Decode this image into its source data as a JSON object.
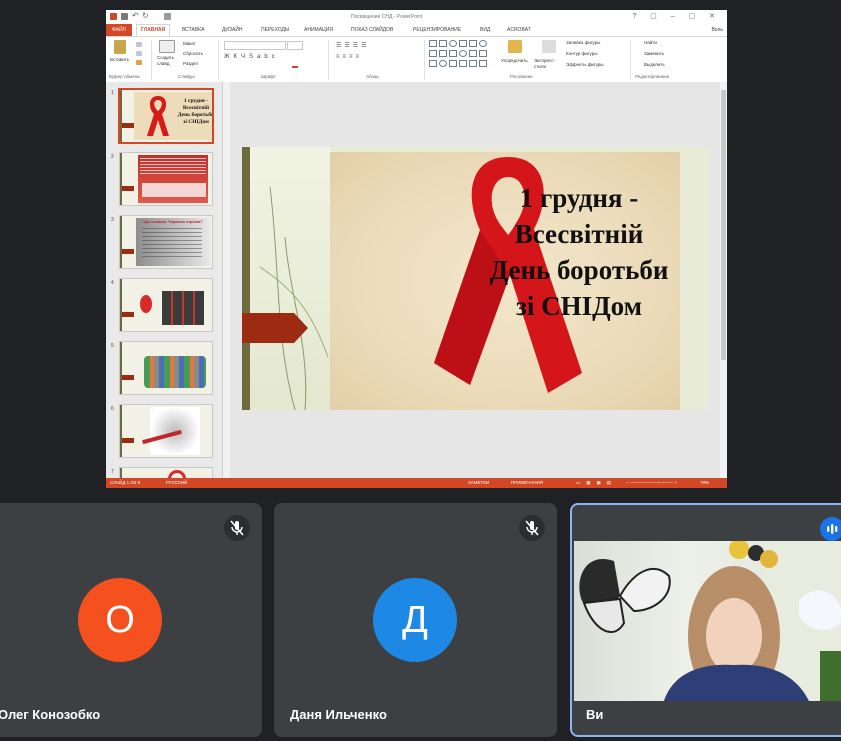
{
  "powerpoint": {
    "window_title": "Посвящение СНД - PowerPoint",
    "user": "Воль",
    "tabs": {
      "file": "ФАЙЛ",
      "home": "ГЛАВНАЯ",
      "insert": "ВСТАВКА",
      "design": "ДИЗАЙН",
      "transitions": "ПЕРЕХОДЫ",
      "animation": "АНИМАЦИЯ",
      "slideshow": "ПОКАЗ СЛАЙДОВ",
      "review": "РЕЦЕНЗИРОВАНИЕ",
      "view": "ВИД",
      "acrobat": "ACROBAT"
    },
    "ribbon": {
      "paste": "Вставить",
      "layout": "Макет",
      "reset": "Сбросить",
      "section": "Раздел",
      "new_slide": "Создать слайд",
      "arrange": "Упорядочить",
      "quick_styles": "Экспресс-стили",
      "fill": "Заливка фигуры",
      "outline": "Контур фигуры",
      "effects": "Эффекты фигуры",
      "find": "Найти",
      "replace": "Заменить",
      "select": "Выделить",
      "groups": {
        "clipboard": "Буфер обмена",
        "slides": "Слайды",
        "font": "Шрифт",
        "paragraph": "Абзац",
        "drawing": "Рисование",
        "editing": "Редактирование"
      }
    },
    "thumbnails": [
      "1",
      "2",
      "3",
      "4",
      "5",
      "6",
      "7"
    ],
    "slide": {
      "title": "1 грудня -\nВсесвітній\nДень боротьби\nзі СНІДом"
    },
    "thumb_titles": {
      "t1": "1 грудня -\nВсесвітній\nДень боротьби\nзі СНІДом",
      "t3": "Що означає Червона стрічка?"
    },
    "status": {
      "slide_info": "СЛАЙД 1 ИЗ 9",
      "language": "РУССКИЙ",
      "notes": "ЗАМЕТКИ",
      "comments": "ПРИМЕЧАНИЯ",
      "zoom": "79%"
    }
  },
  "participants": [
    {
      "name": "Олег Конозобко",
      "initial": "О",
      "color": "#f4511e"
    },
    {
      "name": "Даня Ильченко",
      "initial": "Д",
      "color": "#1e88e5"
    },
    {
      "name": "Ви"
    }
  ]
}
